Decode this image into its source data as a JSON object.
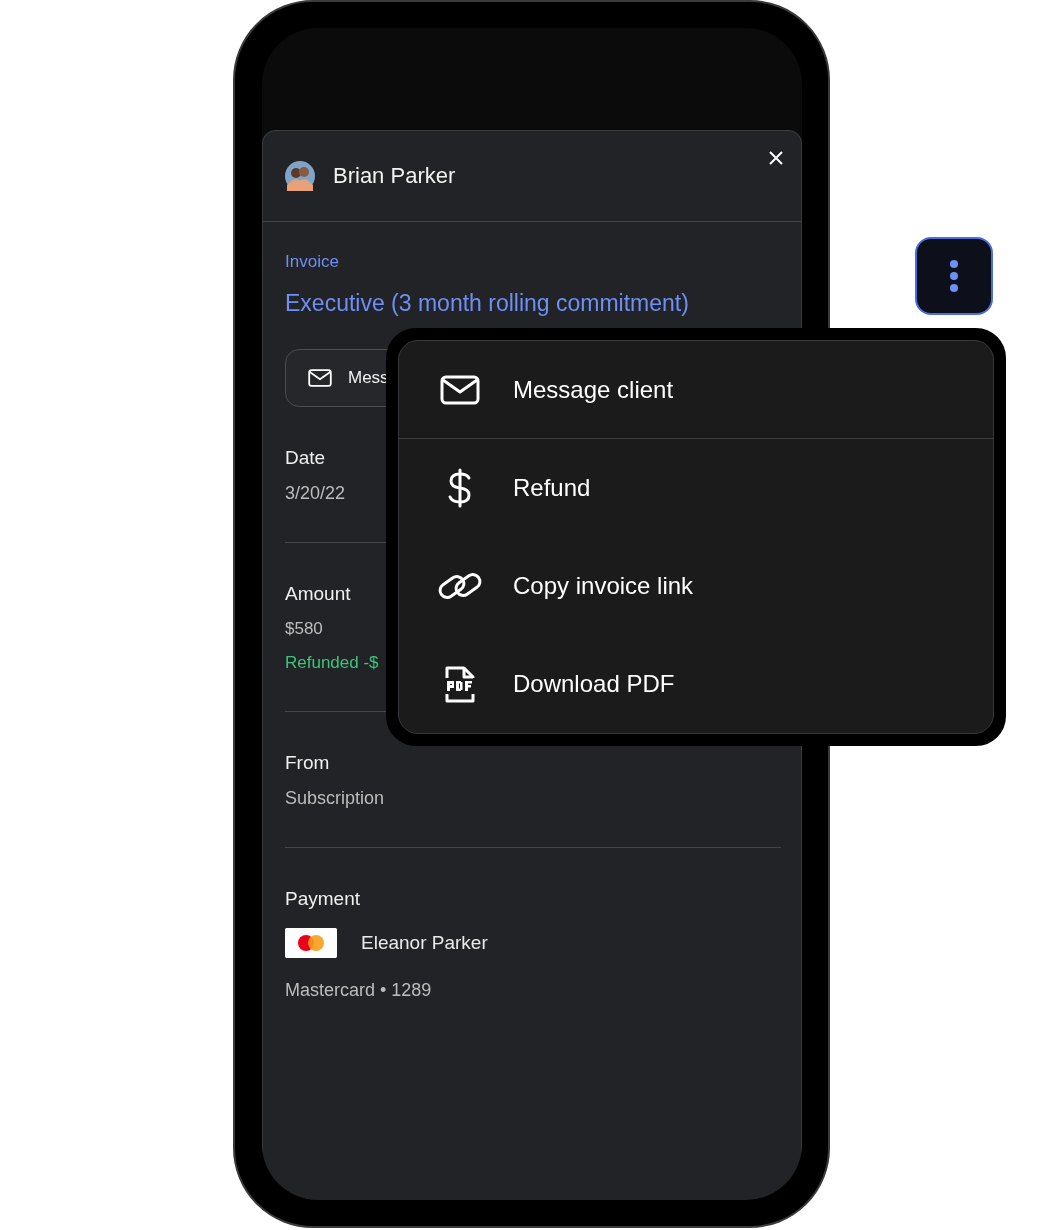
{
  "contact": {
    "name": "Brian Parker"
  },
  "invoice": {
    "label": "Invoice",
    "title": "Executive (3 month rolling commitment)"
  },
  "message_button": {
    "label": "Mess"
  },
  "fields": [
    {
      "label": "Date",
      "value": "3/20/22"
    },
    {
      "label": "Amount",
      "value": "$580",
      "note": "Refunded -$"
    },
    {
      "label": "From",
      "value": "Subscription"
    }
  ],
  "payment": {
    "label": "Payment",
    "name": "Eleanor Parker",
    "card": "Mastercard • 1289"
  },
  "menu": {
    "items": [
      {
        "kind": "mail",
        "label": "Message client"
      },
      {
        "kind": "dollar",
        "label": "Refund"
      },
      {
        "kind": "link",
        "label": "Copy invoice link"
      },
      {
        "kind": "pdf",
        "label": "Download PDF"
      }
    ]
  }
}
